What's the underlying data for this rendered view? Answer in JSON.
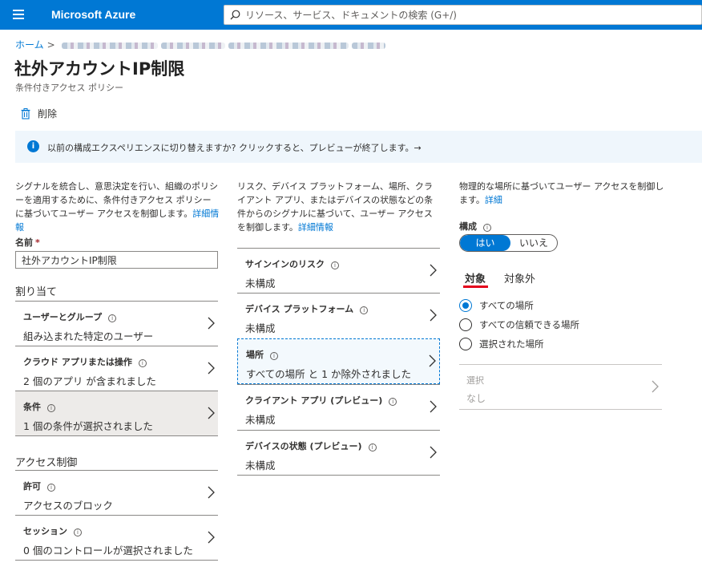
{
  "app": {
    "title": "Microsoft Azure"
  },
  "search": {
    "placeholder": "リソース、サービス、ドキュメントの検索 (G+/)"
  },
  "breadcrumb": {
    "home": "ホーム"
  },
  "page": {
    "title": "社外アカウントIP制限",
    "subtitle": "条件付きアクセス ポリシー"
  },
  "toolbar": {
    "delete_label": "削除"
  },
  "banner": {
    "text": "以前の構成エクスペリエンスに切り替えますか? クリックすると、プレビューが終了します。→"
  },
  "left": {
    "description": "シグナルを統合し、意思決定を行い、組織のポリシーを適用するために、条件付きアクセス ポリシーに基づいてユーザー アクセスを制御します。",
    "link": "詳細情報",
    "name_label": "名前",
    "name_value": "社外アカウントIP制限",
    "assign_heading": "割り当て",
    "assign_items": [
      {
        "label": "ユーザーとグループ",
        "value": "組み込まれた特定のユーザー"
      },
      {
        "label": "クラウド アプリまたは操作",
        "value": "2 個のアプリ が含まれました"
      },
      {
        "label": "条件",
        "value": "1 個の条件が選択されました"
      }
    ],
    "access_heading": "アクセス制御",
    "access_items": [
      {
        "label": "許可",
        "value": "アクセスのブロック"
      },
      {
        "label": "セッション",
        "value": "0 個のコントロールが選択されました"
      }
    ]
  },
  "middle": {
    "description": "リスク、デバイス プラットフォーム、場所、クライアント アプリ、またはデバイスの状態などの条件からのシグナルに基づいて、ユーザー アクセスを制御します。",
    "link": "詳細情報",
    "items": [
      {
        "label": "サインインのリスク",
        "value": "未構成"
      },
      {
        "label": "デバイス プラットフォーム",
        "value": "未構成"
      },
      {
        "label": "場所",
        "value": "すべての場所 と 1 か除外されました"
      },
      {
        "label": "クライアント アプリ (プレビュー)",
        "value": "未構成"
      },
      {
        "label": "デバイスの状態 (プレビュー)",
        "value": "未構成"
      }
    ]
  },
  "right": {
    "description": "物理的な場所に基づいてユーザー アクセスを制御します。",
    "link": "詳細",
    "config_label": "構成",
    "toggle_yes": "はい",
    "toggle_no": "いいえ",
    "tab_include": "対象",
    "tab_exclude": "対象外",
    "radios": [
      "すべての場所",
      "すべての信頼できる場所",
      "選択された場所"
    ],
    "select_label": "選択",
    "select_value": "なし"
  },
  "colors": {
    "accent": "#0078d4",
    "underline": "#e3001b"
  }
}
